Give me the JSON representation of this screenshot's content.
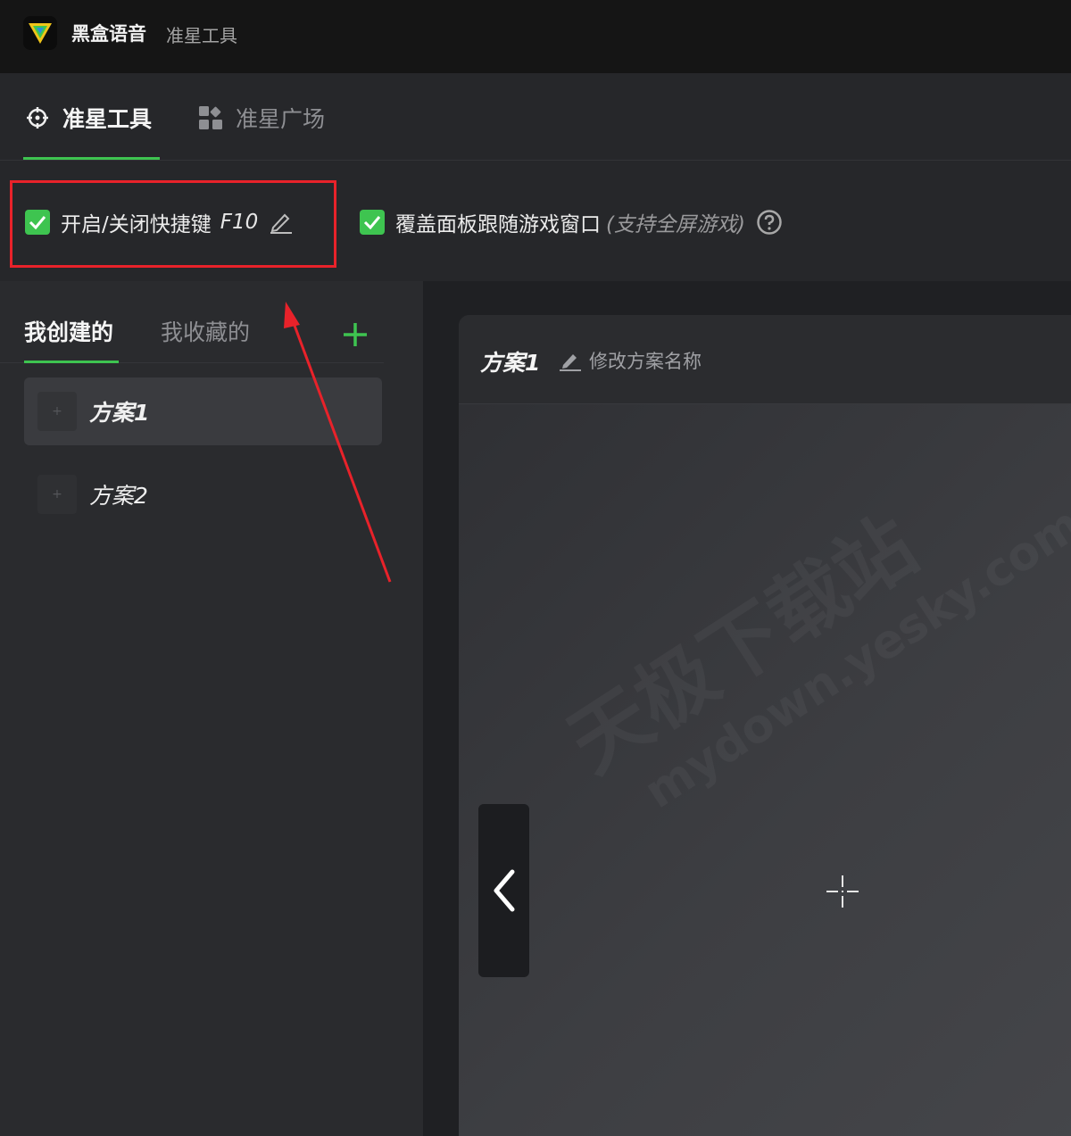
{
  "app": {
    "name": "黑盒语音",
    "subtitle": "准星工具"
  },
  "tabs": [
    {
      "label": "准星工具",
      "active": true,
      "icon": "crosshair-icon"
    },
    {
      "label": "准星广场",
      "active": false,
      "icon": "grid-icon"
    }
  ],
  "options": {
    "hotkey_toggle": {
      "label": "开启/关闭快捷键",
      "key": "F10",
      "checked": true
    },
    "overlay_follow": {
      "label": "覆盖面板跟随游戏窗口",
      "note": "(支持全屏游戏)",
      "checked": true
    }
  },
  "plans_panel": {
    "tabs": [
      {
        "label": "我创建的",
        "active": true
      },
      {
        "label": "我收藏的",
        "active": false
      }
    ],
    "items": [
      {
        "label": "方案1",
        "selected": true
      },
      {
        "label": "方案2",
        "selected": false
      }
    ]
  },
  "plan_editor": {
    "title": "方案1",
    "rename_label": "修改方案名称"
  },
  "watermark": {
    "line1": "天极下载站",
    "line2": "mydown.yesky.com"
  },
  "colors": {
    "accent": "#3ec450",
    "highlight": "#e8222a",
    "background": "#1f2023"
  }
}
